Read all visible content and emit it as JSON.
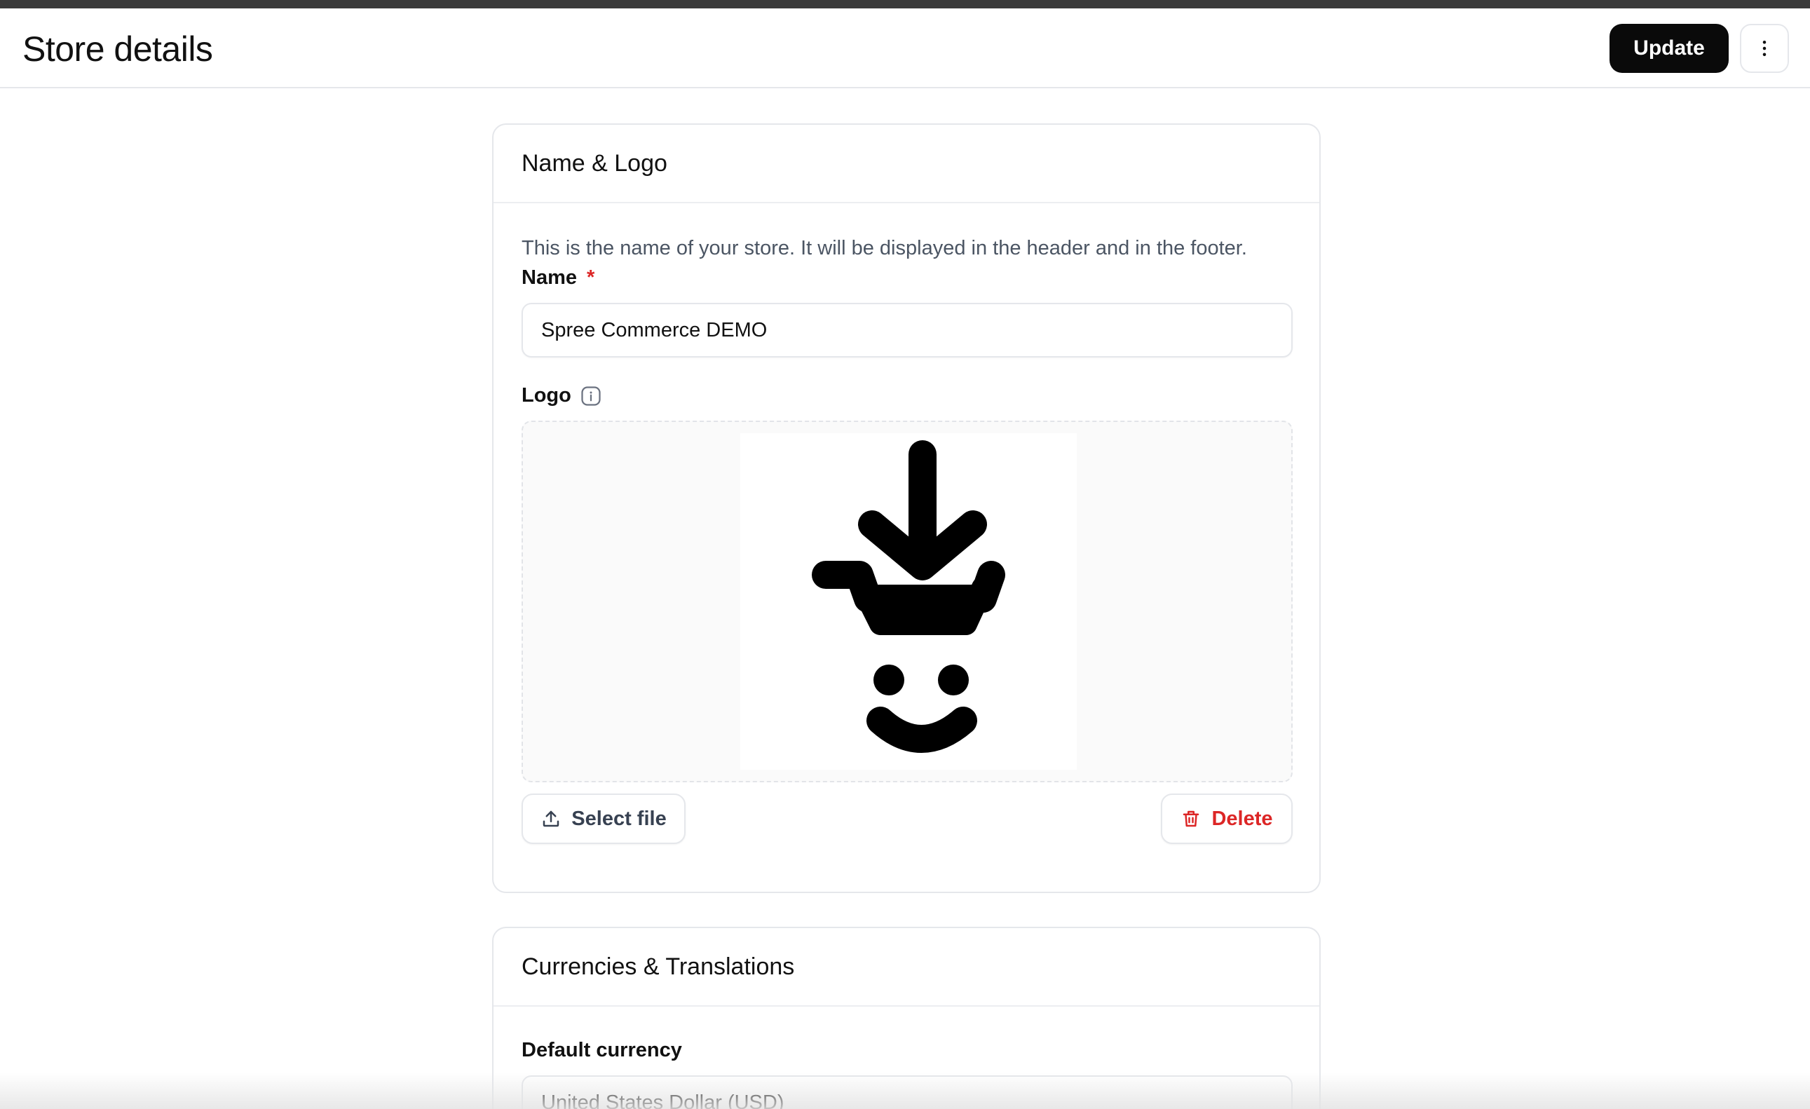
{
  "header": {
    "title": "Store details",
    "update_label": "Update",
    "more_icon": "more-vertical-icon"
  },
  "name_logo": {
    "title": "Name & Logo",
    "help_text": "This is the name of your store. It will be displayed in the header and in the footer.",
    "name_label": "Name",
    "required_marker": "*",
    "name_value": "Spree Commerce DEMO",
    "logo_label": "Logo",
    "logo_info_icon": "info-icon",
    "select_file_label": "Select file",
    "select_file_icon": "upload-icon",
    "delete_label": "Delete",
    "delete_icon": "trash-icon"
  },
  "currencies": {
    "title": "Currencies & Translations",
    "default_currency_label": "Default currency",
    "default_currency_value": "United States Dollar (USD)"
  },
  "colors": {
    "primary": "#0a0a0a",
    "danger": "#dc2626",
    "border": "#e5e7eb",
    "muted_text": "#4b5563"
  }
}
